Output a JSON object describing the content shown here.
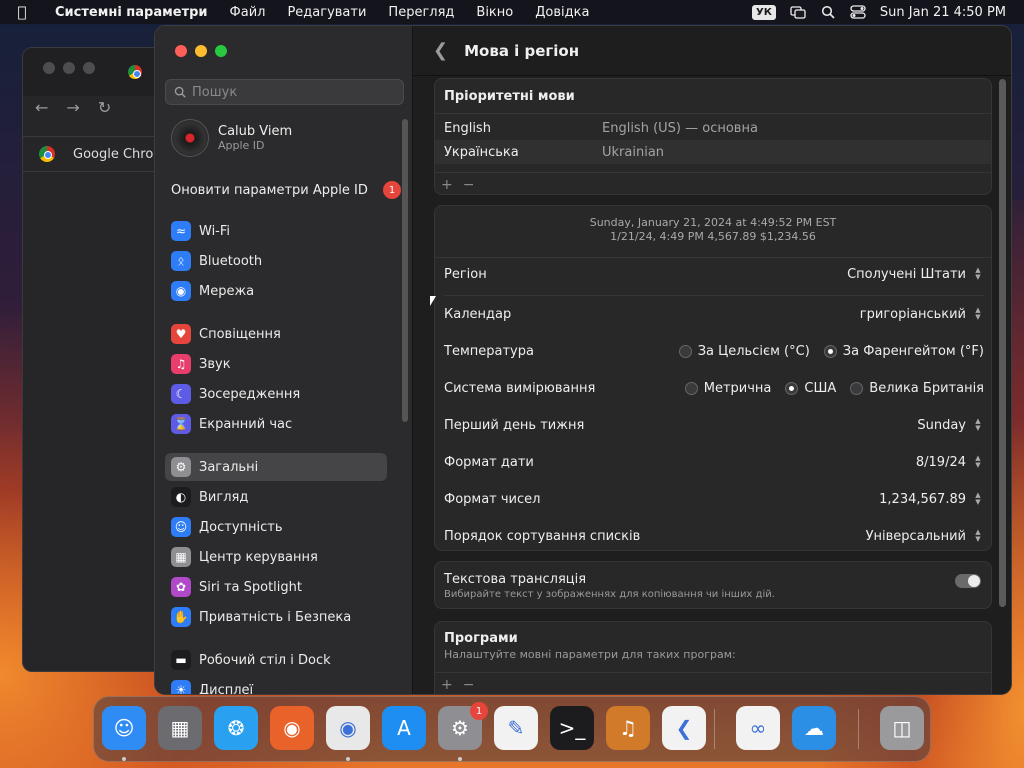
{
  "menubar": {
    "app": "Системні параметри",
    "items": [
      "Файл",
      "Редагувати",
      "Перегляд",
      "Вікно",
      "Довідка"
    ],
    "input_source": "УК",
    "datetime": "Sun Jan 21  4:50 PM"
  },
  "chrome": {
    "tab_title": "Google Chrom"
  },
  "sidebar": {
    "search_placeholder": "Пошук",
    "profile_name": "Calub Viem",
    "profile_sub": "Apple ID",
    "update_label": "Оновити параметри Apple ID",
    "update_badge": "1",
    "items": [
      {
        "label": "Wi-Fi",
        "icon": "wifi-icon",
        "color": "#2f7df6"
      },
      {
        "label": "Bluetooth",
        "icon": "bluetooth-icon",
        "color": "#2f7df6"
      },
      {
        "label": "Мережа",
        "icon": "globe-icon",
        "color": "#2f7df6"
      },
      {
        "label": "Сповіщення",
        "icon": "bell-icon",
        "color": "#e5453b"
      },
      {
        "label": "Звук",
        "icon": "speaker-icon",
        "color": "#e83e6b"
      },
      {
        "label": "Зосередження",
        "icon": "moon-icon",
        "color": "#5e5ce6"
      },
      {
        "label": "Екранний час",
        "icon": "hourglass-icon",
        "color": "#5e5ce6"
      },
      {
        "label": "Загальні",
        "icon": "gear-icon",
        "color": "#8e8e93"
      },
      {
        "label": "Вигляд",
        "icon": "appearance-icon",
        "color": "#1c1c1e"
      },
      {
        "label": "Доступність",
        "icon": "accessibility-icon",
        "color": "#2f7df6"
      },
      {
        "label": "Центр керування",
        "icon": "control-center-icon",
        "color": "#8e8e93"
      },
      {
        "label": "Siri та Spotlight",
        "icon": "siri-icon",
        "color": "#b04ac9"
      },
      {
        "label": "Приватність і Безпека",
        "icon": "hand-icon",
        "color": "#2f7df6"
      },
      {
        "label": "Робочий стіл і Dock",
        "icon": "desktop-icon",
        "color": "#1c1c1e"
      },
      {
        "label": "Дисплеї",
        "icon": "display-icon",
        "color": "#2f7df6"
      }
    ]
  },
  "content": {
    "title": "Мова і регіон",
    "preferred": {
      "title": "Пріоритетні мови",
      "rows": [
        {
          "name": "English",
          "detail": "English (US) — основна"
        },
        {
          "name": "Українська",
          "detail": "Ukrainian"
        }
      ],
      "add": "+",
      "remove": "−"
    },
    "sample_line1": "Sunday, January 21, 2024 at 4:49:52 PM EST",
    "sample_line2": "1/21/24, 4:49 PM     4,567.89     $1,234.56",
    "region": {
      "label": "Регіон",
      "value": "Сполучені Штати"
    },
    "calendar": {
      "label": "Календар",
      "value": "григоріанський"
    },
    "temperature": {
      "label": "Температура",
      "options": [
        "За Цельсієм (°C)",
        "За Фаренгейтом (°F)"
      ],
      "selected": 1
    },
    "measurement": {
      "label": "Система вимірювання",
      "options": [
        "Метрична",
        "США",
        "Велика Британія"
      ],
      "selected": 1
    },
    "first_day": {
      "label": "Перший день тижня",
      "value": "Sunday"
    },
    "date_format": {
      "label": "Формат дати",
      "value": "8/19/24"
    },
    "number_format": {
      "label": "Формат чисел",
      "value": "1,234,567.89"
    },
    "sort_order": {
      "label": "Порядок сортування списків",
      "value": "Універсальний"
    },
    "live_text": {
      "label": "Текстова трансляція",
      "sub": "Вибирайте текст у зображеннях для копіювання чи інших дій.",
      "on": true
    },
    "apps": {
      "title": "Програми",
      "sub": "Налаштуйте мовні параметри для таких програм:",
      "add": "+",
      "remove": "−"
    }
  },
  "dock": {
    "items": [
      {
        "name": "finder-icon",
        "color": "#2f8cf4",
        "running": true
      },
      {
        "name": "launchpad-icon",
        "color": "#6b6b70",
        "running": false
      },
      {
        "name": "safari-icon",
        "color": "#2aa0f0",
        "running": false
      },
      {
        "name": "firefox-icon",
        "color": "#e8622a",
        "running": false
      },
      {
        "name": "chrome-icon",
        "color": "#e8e8e8",
        "running": true
      },
      {
        "name": "app-store-icon",
        "color": "#1f8ef2",
        "running": false
      },
      {
        "name": "system-settings-icon",
        "color": "#8e8e93",
        "running": true,
        "badge": "1"
      },
      {
        "name": "textedit-icon",
        "color": "#f2f2f2",
        "running": false
      },
      {
        "name": "terminal-icon",
        "color": "#1c1c1e",
        "running": false
      },
      {
        "name": "garageband-icon",
        "color": "#d07a2a",
        "running": false
      },
      {
        "name": "vscode-icon",
        "color": "#f2f2f2",
        "running": false
      },
      {
        "name": "visual-studio-icon",
        "color": "#f2f2f2",
        "running": false
      },
      {
        "name": "weather-icon",
        "color": "#2c8fe6",
        "running": false
      },
      {
        "name": "trash-icon",
        "color": "#9a9a9c",
        "running": false
      }
    ]
  }
}
